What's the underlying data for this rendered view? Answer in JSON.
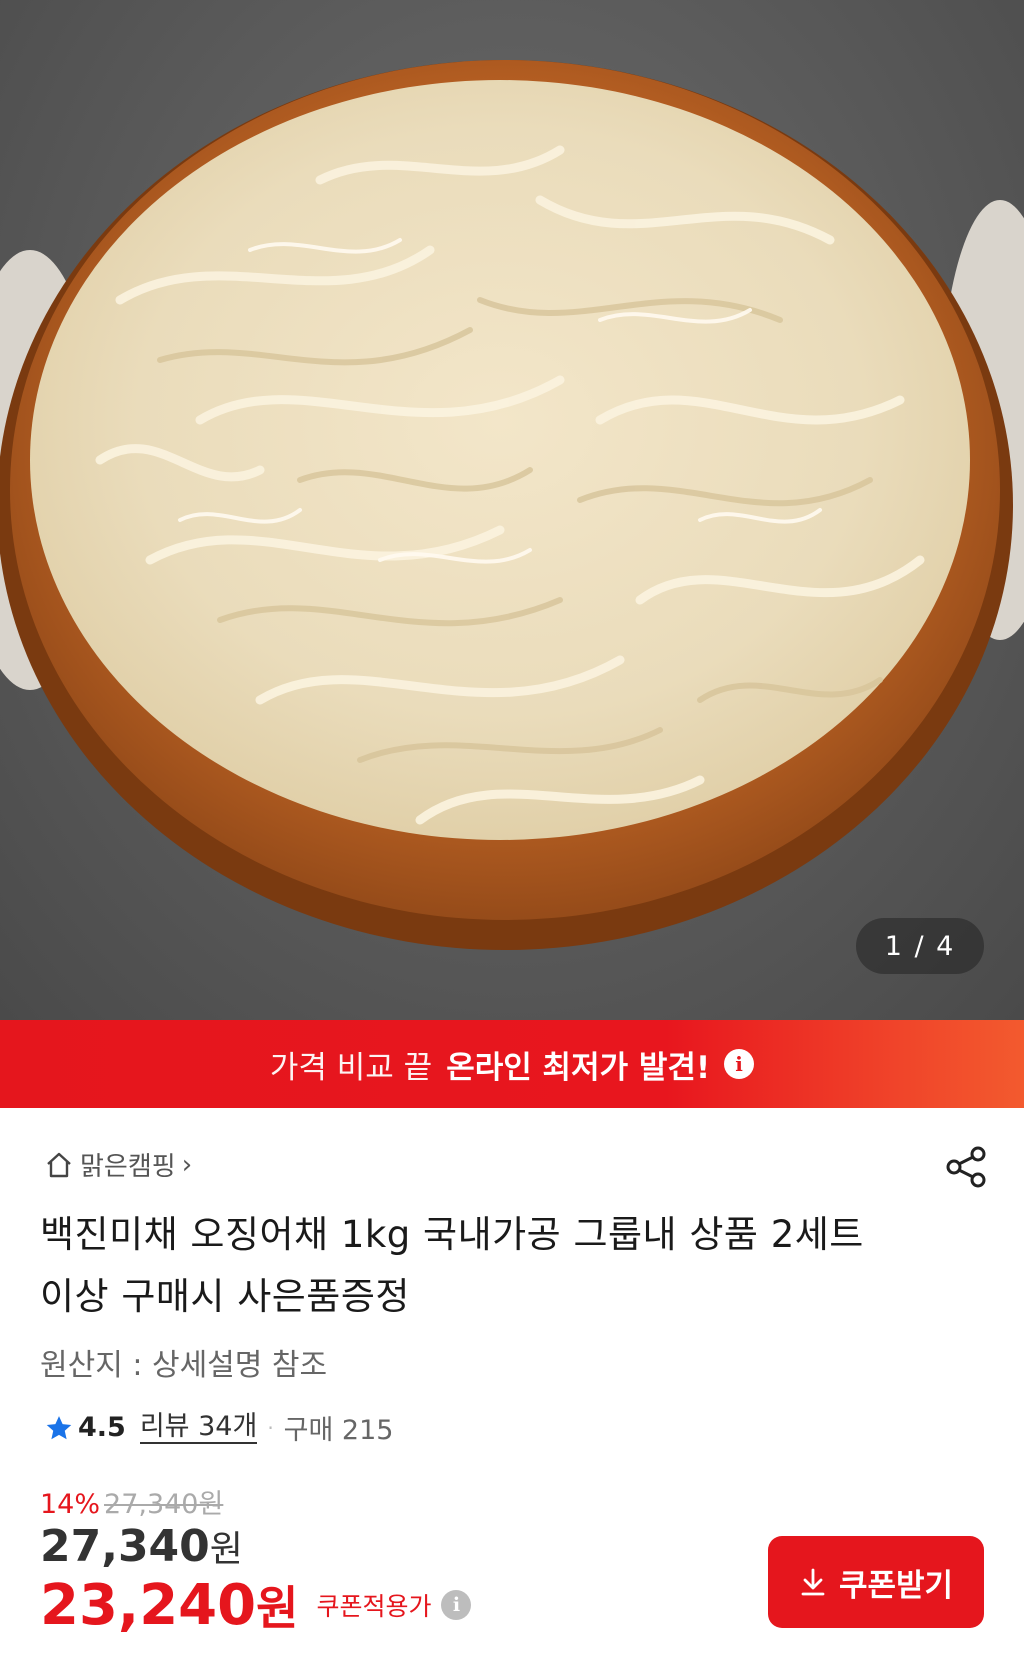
{
  "gallery": {
    "image_alt": "product-photo",
    "counter": "1 / 4"
  },
  "banner": {
    "text_normal": "가격 비교 끝",
    "text_strong": "온라인 최저가 발견!",
    "info_glyph": "i"
  },
  "store": {
    "name": "맑은캠핑",
    "chevron": "›"
  },
  "product": {
    "title": "백진미채 오징어채 1kg 국내가공 그룹내 상품 2세트이상 구매시 사은품증정",
    "origin": "원산지 : 상세설명 참조"
  },
  "rating": {
    "score": "4.5",
    "reviews": "리뷰 34개",
    "separator": "·",
    "purchases": "구매 215"
  },
  "price": {
    "discount": "14%",
    "original": "27,340원",
    "current_value": "27,340",
    "current_unit": "원",
    "coupon_value": "23,240",
    "coupon_unit": "원",
    "coupon_label": "쿠폰적용가",
    "info_glyph": "i"
  },
  "coupon_button": {
    "label": "쿠폰받기"
  },
  "colors": {
    "accent": "#e5161d",
    "star": "#1a73e8"
  }
}
